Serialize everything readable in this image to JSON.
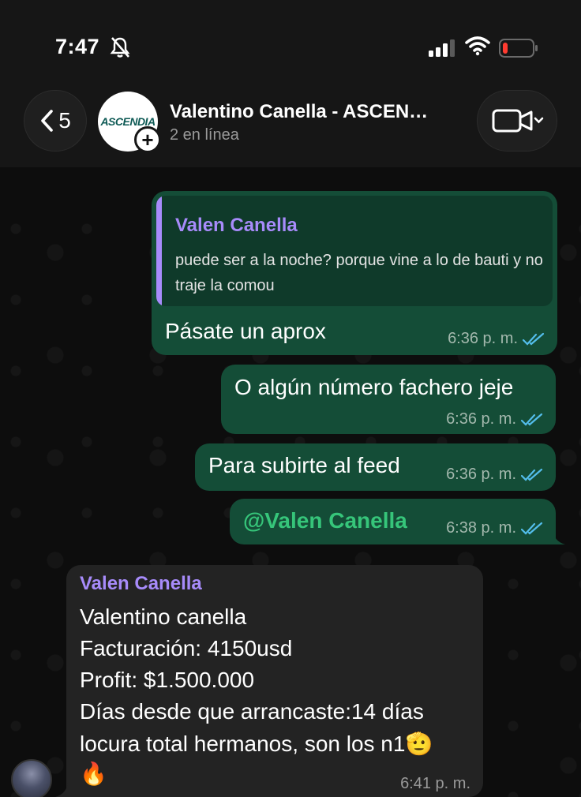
{
  "status_bar": {
    "time": "7:47"
  },
  "header": {
    "back_count": "5",
    "avatar_logo": "ASCENDIA",
    "title": "Valentino Canella - ASCEN…",
    "subtitle": "2 en línea"
  },
  "messages": [
    {
      "direction": "outgoing",
      "quote": {
        "author": "Valen Canella",
        "text": "puede ser a la noche? porque vine a lo de bauti y no traje la comou"
      },
      "text": "Pásate un aprox",
      "time": "6:36 p. m.",
      "status": "read"
    },
    {
      "direction": "outgoing",
      "text": "O algún número fachero jeje",
      "time": "6:36 p. m.",
      "status": "read"
    },
    {
      "direction": "outgoing",
      "text": "Para subirte al feed",
      "time": "6:36 p. m.",
      "status": "read"
    },
    {
      "direction": "outgoing",
      "text": "@Valen Canella",
      "time": "6:38 p. m.",
      "status": "read"
    },
    {
      "direction": "incoming",
      "sender": "Valen Canella",
      "lines": [
        "Valentino canella",
        "Facturación: 4150usd",
        "Profit: $1.500.000",
        "Días desde que arrancaste:14 días",
        "locura total hermanos, son los n1🫡",
        "🔥"
      ],
      "time": "6:41 p. m."
    }
  ],
  "colors": {
    "outgoing_bubble": "#144d37",
    "incoming_bubble": "#232323",
    "sender_name": "#a78bfa",
    "mention": "#36c57a",
    "read_ticks": "#53bdeb"
  }
}
